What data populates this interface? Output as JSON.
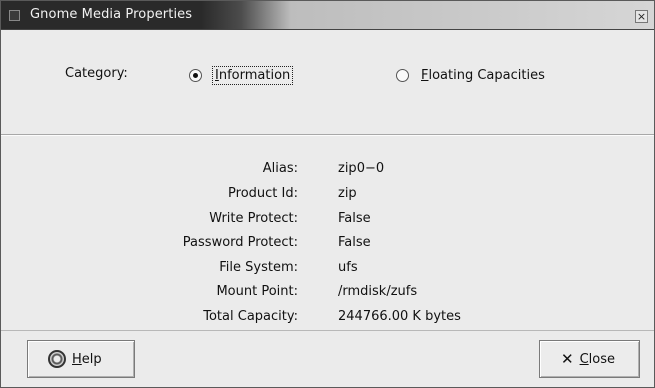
{
  "window": {
    "title": "Gnome Media Properties",
    "close_glyph": "×"
  },
  "category": {
    "label": "Category:",
    "options": [
      {
        "mnemonic": "I",
        "rest": "nformation",
        "selected": true
      },
      {
        "mnemonic": "F",
        "rest": "loating Capacities",
        "selected": false
      }
    ]
  },
  "info": [
    {
      "label": "Alias:",
      "value": "zip0−0"
    },
    {
      "label": "Product Id:",
      "value": "zip"
    },
    {
      "label": "Write Protect:",
      "value": "False"
    },
    {
      "label": "Password Protect:",
      "value": "False"
    },
    {
      "label": "File System:",
      "value": "ufs"
    },
    {
      "label": "Mount Point:",
      "value": "/rmdisk/zufs"
    },
    {
      "label": "Total Capacity:",
      "value": "244766.00 K bytes"
    }
  ],
  "buttons": {
    "help": {
      "mnemonic": "H",
      "rest": "elp",
      "icon": "help-lifebuoy-icon"
    },
    "close": {
      "glyph": "✕",
      "mnemonic": "C",
      "rest": "lose",
      "icon": "x-icon"
    }
  }
}
